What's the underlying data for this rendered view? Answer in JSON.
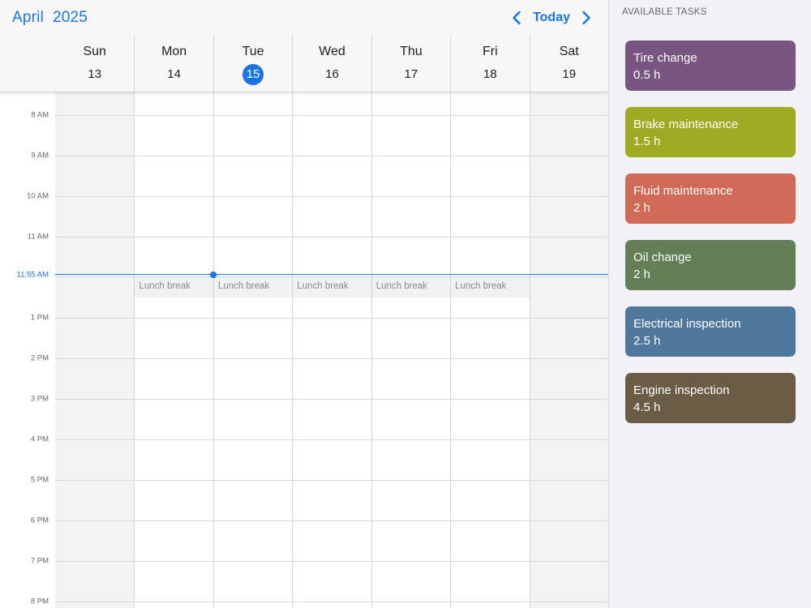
{
  "header": {
    "month": "April",
    "year": "2025",
    "today_label": "Today"
  },
  "days": [
    {
      "name": "Sun",
      "num": "13",
      "weekend": true,
      "today": false
    },
    {
      "name": "Mon",
      "num": "14",
      "weekend": false,
      "today": false
    },
    {
      "name": "Tue",
      "num": "15",
      "weekend": false,
      "today": true
    },
    {
      "name": "Wed",
      "num": "16",
      "weekend": false,
      "today": false
    },
    {
      "name": "Thu",
      "num": "17",
      "weekend": false,
      "today": false
    },
    {
      "name": "Fri",
      "num": "18",
      "weekend": false,
      "today": false
    },
    {
      "name": "Sat",
      "num": "19",
      "weekend": true,
      "today": false
    }
  ],
  "times": [
    "8 AM",
    "9 AM",
    "10 AM",
    "11 AM",
    "1 PM",
    "2 PM",
    "3 PM",
    "4 PM",
    "5 PM",
    "6 PM",
    "7 PM",
    "8 PM"
  ],
  "current_time": "11:55 AM",
  "lunch_label": "Lunch break",
  "tasks_panel": {
    "title": "AVAILABLE TASKS",
    "items": [
      {
        "name": "Tire change",
        "duration": "0.5 h",
        "color": "#795682"
      },
      {
        "name": "Brake maintenance",
        "duration": "1.5 h",
        "color": "#9fab22"
      },
      {
        "name": "Fluid maintenance",
        "duration": "2 h",
        "color": "#cf6a57"
      },
      {
        "name": "Oil change",
        "duration": "2 h",
        "color": "#647f55"
      },
      {
        "name": "Electrical inspection",
        "duration": "2.5 h",
        "color": "#50779c"
      },
      {
        "name": "Engine inspection",
        "duration": "4.5 h",
        "color": "#6b5d45"
      }
    ]
  },
  "colors": {
    "accent": "#1a73e8"
  }
}
